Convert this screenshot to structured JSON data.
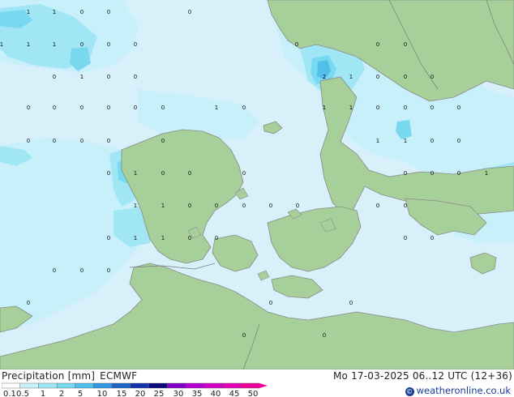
{
  "title": {
    "product": "Precipitation [mm]",
    "model": "ECMWF",
    "datetime": "Mo 17-03-2025 06..12 UTC (12+36)"
  },
  "copyright": "weatheronline.co.uk",
  "legend": {
    "labels": [
      "0.1",
      "0.5",
      "1",
      "2",
      "5",
      "10",
      "15",
      "20",
      "25",
      "30",
      "35",
      "40",
      "45",
      "50"
    ],
    "colors": [
      "#ffffff",
      "#c8f0fa",
      "#a0e6f5",
      "#78d8f0",
      "#50c0eb",
      "#3296e1",
      "#1e64c8",
      "#1432aa",
      "#0a0a78",
      "#8200c8",
      "#b400d2",
      "#d200c8",
      "#e600b4",
      "#f0009b"
    ]
  },
  "colors": {
    "sea": "#d7f0fa",
    "land": "#a7cf9a",
    "precip_light": "#c8f0fa",
    "precip_medium": "#a0e6f5",
    "precip_heavy": "#78d8f0",
    "precip_core": "#50c0eb"
  },
  "grid_values": [
    {
      "row": 1,
      "values": [
        "1",
        "1",
        "0",
        "0",
        "0"
      ]
    },
    {
      "row": 2,
      "values": [
        "1",
        "1",
        "1",
        "0",
        "0",
        "0",
        "0",
        "0",
        "0"
      ]
    },
    {
      "row": 3,
      "values": [
        "0",
        "1",
        "0",
        "0",
        "2",
        "1",
        "0",
        "0",
        "0"
      ]
    },
    {
      "row": 4,
      "values": [
        "0",
        "0",
        "0",
        "0",
        "0",
        "0",
        "1",
        "0",
        "1",
        "1",
        "0",
        "0",
        "0",
        "0"
      ]
    },
    {
      "row": 5,
      "values": [
        "0",
        "0",
        "0",
        "0",
        "0",
        "1",
        "1",
        "0",
        "0"
      ]
    },
    {
      "row": 6,
      "values": [
        "0",
        "1",
        "0",
        "0",
        "0",
        "0",
        "0",
        "0",
        "1"
      ]
    },
    {
      "row": 7,
      "values": [
        "1",
        "1",
        "0",
        "0",
        "0",
        "0",
        "0",
        "0",
        "0"
      ]
    },
    {
      "row": 8,
      "values": [
        "0",
        "1",
        "1",
        "0",
        "0",
        "0",
        "0"
      ]
    },
    {
      "row": 9,
      "values": [
        "0",
        "0",
        "0"
      ]
    },
    {
      "row": 10,
      "values": [
        "0",
        "0",
        "0"
      ]
    },
    {
      "row": 11,
      "values": [
        "0",
        "0"
      ]
    }
  ]
}
